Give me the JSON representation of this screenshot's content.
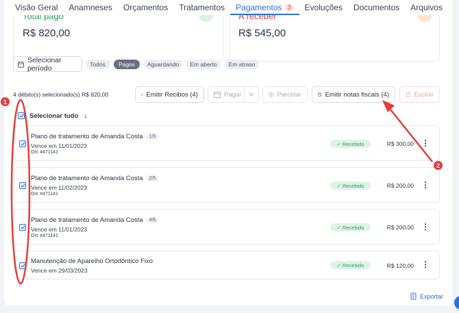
{
  "tabs": [
    {
      "label": "Visão Geral"
    },
    {
      "label": "Anamneses"
    },
    {
      "label": "Orçamentos"
    },
    {
      "label": "Tratamentos"
    },
    {
      "label": "Pagamentos",
      "badge": "3",
      "active": true
    },
    {
      "label": "Evoluções"
    },
    {
      "label": "Documentos"
    },
    {
      "label": "Arquivos"
    }
  ],
  "summary": {
    "paid_label": "Total pago",
    "paid_value": "R$ 820,00",
    "receivable_label": "A receber",
    "receivable_value": "R$ 545,00"
  },
  "filters": {
    "period_label": "Selecionar período",
    "chips": [
      {
        "label": "Todos"
      },
      {
        "label": "Pagos",
        "active": true
      },
      {
        "label": "Aguardando"
      },
      {
        "label": "Em aberto"
      },
      {
        "label": "Em atraso"
      }
    ]
  },
  "actions": {
    "selection_info": "4 débito(s) selecionado(s)  R$ 820,00",
    "receipts": "Emitir Recibos (4)",
    "pay": "Pagar",
    "installments": "Parcelar",
    "invoices": "Emitir notas fiscais (4)",
    "delete": "Excluir"
  },
  "select_all_label": "Selecionar tudo",
  "rows": [
    {
      "title": "Plano de tratamento de Amanda Costa",
      "fraction": "1/5",
      "due": "Vence em 11/01/2023",
      "rc": "Orc #471141",
      "status": "✓ Recebido",
      "amount": "R$ 300,00"
    },
    {
      "title": "Plano de tratamento de Amanda Costa",
      "fraction": "2/5",
      "due": "Vence em 11/02/2023",
      "rc": "Orc #471141",
      "status": "✓ Recebido",
      "amount": "R$ 200,00"
    },
    {
      "title": "Plano de tratamento de Amanda Costa",
      "fraction": "4/5",
      "due": "Vence em 11/01/2023",
      "rc": "Orc #471141",
      "status": "✓ Recebido",
      "amount": "R$ 200,00"
    },
    {
      "title": "Manutenção de Aparelho Ortodôntico Fixo",
      "due": "Vence em 29/03/2023",
      "status": "✓ Recebido",
      "amount": "R$ 120,00"
    }
  ],
  "export_label": "Exportar",
  "annotations": {
    "marker_1": "1",
    "marker_2": "2"
  },
  "colors": {
    "accent": "#2c6fe0",
    "paid": "#27a05a",
    "danger": "#d04545",
    "annotation": "#e83a3a"
  }
}
